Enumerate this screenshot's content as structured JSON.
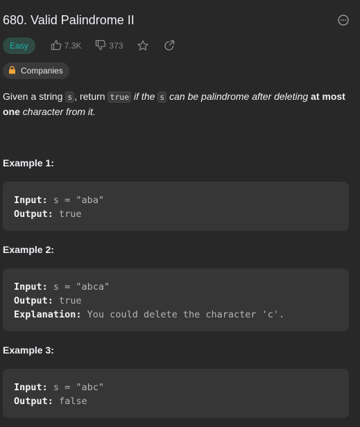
{
  "problem": {
    "title": "680. Valid Palindrome II",
    "difficulty": "Easy",
    "likes": "7.3K",
    "dislikes": "373",
    "companies_label": "Companies"
  },
  "description": {
    "p1": "Given a string ",
    "code_s": "s",
    "p2": ", return ",
    "code_true": "true",
    "p3": " if the ",
    "code_s2": "s",
    "p4": " can be palindrome after deleting ",
    "bold": "at most one",
    "p5": " character from it."
  },
  "examples": [
    {
      "label": "Example 1:",
      "input_key": "Input:",
      "input_val": " s = \"aba\"",
      "output_key": "Output:",
      "output_val": " true"
    },
    {
      "label": "Example 2:",
      "input_key": "Input:",
      "input_val": " s = \"abca\"",
      "output_key": "Output:",
      "output_val": " true",
      "expl_key": "Explanation:",
      "expl_val": " You could delete the character 'c'."
    },
    {
      "label": "Example 3:",
      "input_key": "Input:",
      "input_val": " s = \"abc\"",
      "output_key": "Output:",
      "output_val": " false"
    }
  ],
  "colors": {
    "background": "#282828",
    "easy_text": "#20b2aa",
    "easy_bg": "#2e4a43",
    "muted": "#8a8a8a"
  },
  "icons": [
    "more-options-icon",
    "thumbs-up-icon",
    "thumbs-down-icon",
    "star-icon",
    "share-icon",
    "lock-icon"
  ]
}
